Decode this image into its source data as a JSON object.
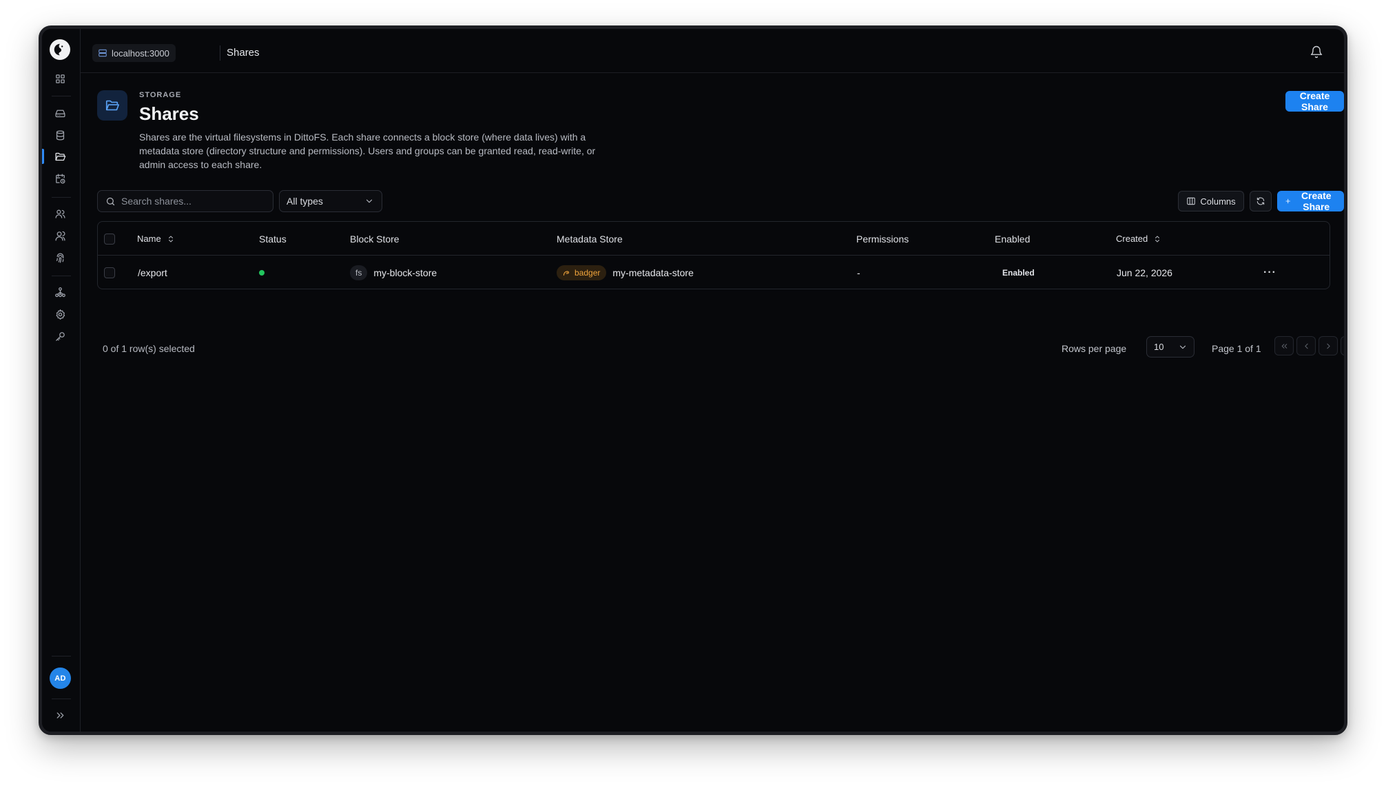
{
  "topbar": {
    "host": "localhost:3000",
    "page": "Shares"
  },
  "header": {
    "eyebrow": "STORAGE",
    "title": "Shares",
    "description": "Shares are the virtual filesystems in DittoFS. Each share connects a block store (where data lives) with a metadata store (directory structure and permissions). Users and groups can be granted read, read-write, or admin access to each share.",
    "create_label": "Create Share"
  },
  "sidebar": {
    "avatar_initials": "AD",
    "items": [
      "dashboard-icon",
      "hard-drive-icon",
      "database-icon",
      "folder-icon",
      "calendar-clock-icon",
      "users-icon",
      "user-group-icon",
      "fingerprint-icon",
      "network-icon",
      "settings-icon",
      "key-icon"
    ],
    "active_item": "folder-icon"
  },
  "toolbar": {
    "search_placeholder": "Search shares...",
    "type_filter": "All types",
    "columns_label": "Columns",
    "create_label": "Create Share"
  },
  "table": {
    "columns": {
      "name": "Name",
      "status": "Status",
      "block_store": "Block Store",
      "metadata_store": "Metadata Store",
      "permissions": "Permissions",
      "enabled": "Enabled",
      "created": "Created"
    },
    "rows": [
      {
        "name": "/export",
        "status": "active",
        "block_store_type": "fs",
        "block_store": "my-block-store",
        "metadata_store_type": "badger",
        "metadata_store": "my-metadata-store",
        "permissions": "-",
        "enabled": "Enabled",
        "created": "Jun 22, 2026",
        "actions": "···"
      }
    ]
  },
  "footer": {
    "selection": "0 of 1 row(s) selected",
    "rows_per_page_label": "Rows per page",
    "rows_per_page": "10",
    "page_info": "Page 1 of 1"
  },
  "colors": {
    "accent": "#1d82f0",
    "status_active": "#22c55e",
    "badger_badge": "#f0a43c",
    "background": "#07080b"
  }
}
